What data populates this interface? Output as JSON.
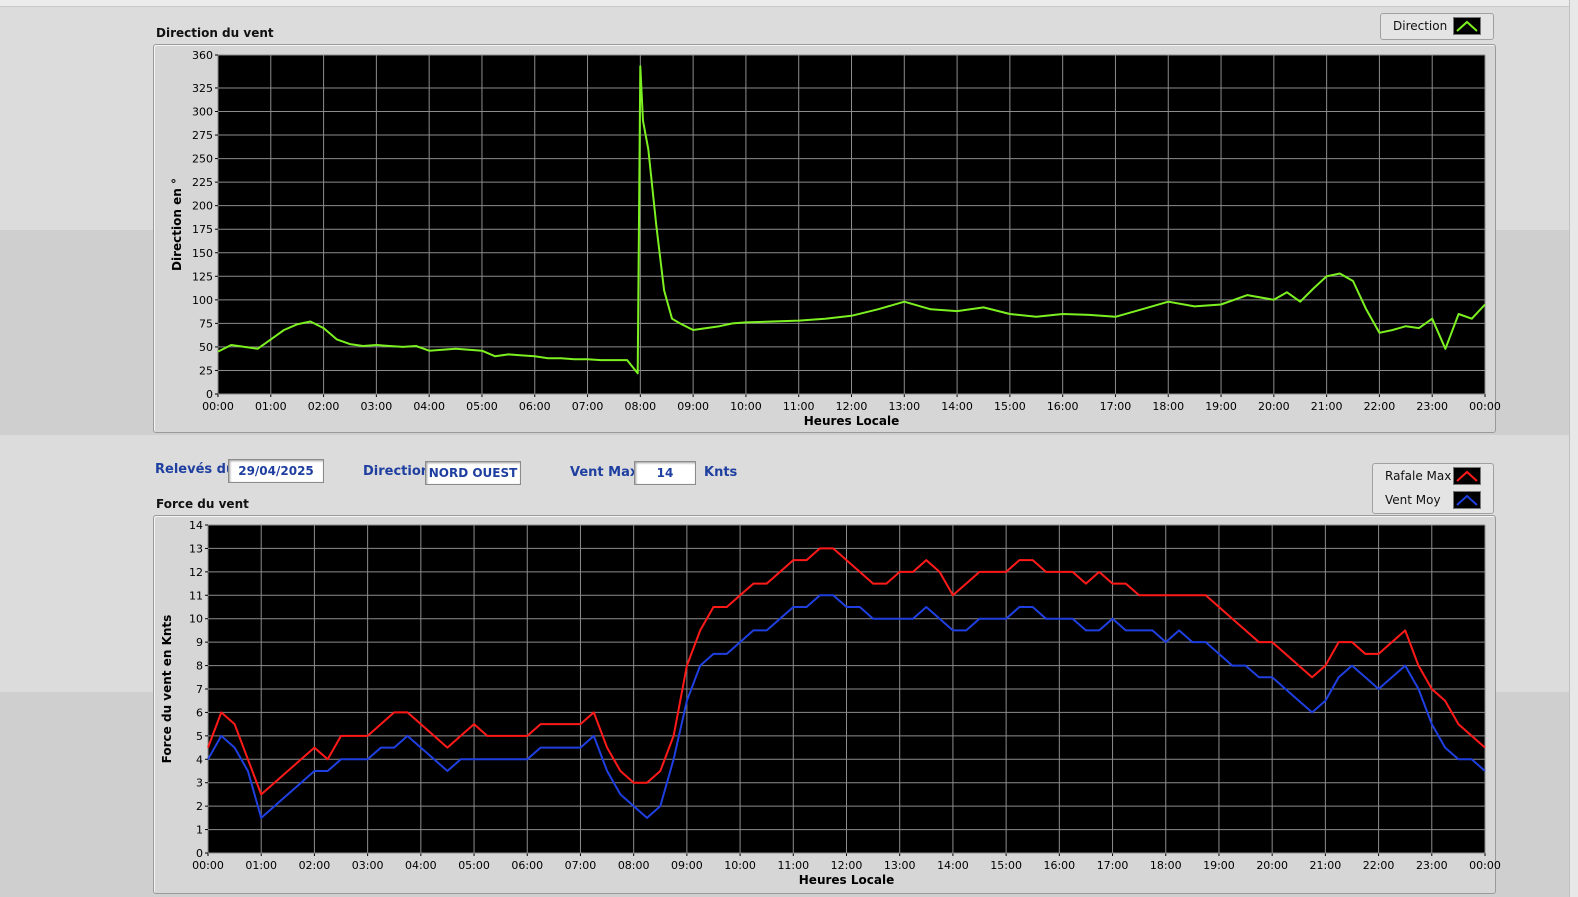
{
  "colors": {
    "plot_bg": "#000000",
    "grid": "#8c8c8c",
    "direction": "#7cf020",
    "rafale": "#ff1a1a",
    "moyen": "#1f3fe0",
    "control_text": "#1e3fa0"
  },
  "controls": {
    "releves_label": "Relevés du",
    "releves_value": "29/04/2025",
    "direction_label": "Direction",
    "direction_value": "NORD OUEST",
    "ventmax_label": "Vent Max",
    "ventmax_value": "14",
    "ventmax_unit": "Knts"
  },
  "legend_top": {
    "label": "Direction"
  },
  "legend_bottom": {
    "items": [
      "Rafale Max",
      "Vent Moy"
    ]
  },
  "chart_data": [
    {
      "type": "line",
      "title": "Direction du vent",
      "xlabel": "Heures Locale",
      "ylabel": "Direction en °",
      "x_ticks": [
        "00:00",
        "01:00",
        "02:00",
        "03:00",
        "04:00",
        "05:00",
        "06:00",
        "07:00",
        "08:00",
        "09:00",
        "10:00",
        "11:00",
        "12:00",
        "13:00",
        "14:00",
        "15:00",
        "16:00",
        "17:00",
        "18:00",
        "19:00",
        "20:00",
        "21:00",
        "22:00",
        "23:00",
        "00:00"
      ],
      "y_ticks": [
        0,
        25,
        50,
        75,
        100,
        125,
        150,
        175,
        200,
        225,
        250,
        275,
        300,
        325,
        360
      ],
      "xlim": [
        0,
        24
      ],
      "ylim": [
        0,
        360
      ],
      "grid": true,
      "legend": "top-right",
      "series": [
        {
          "name": "Direction",
          "x": [
            0,
            0.25,
            0.5,
            0.75,
            1,
            1.25,
            1.5,
            1.75,
            2,
            2.25,
            2.5,
            2.75,
            3,
            3.25,
            3.5,
            3.75,
            4,
            4.25,
            4.5,
            4.75,
            5,
            5.25,
            5.5,
            5.75,
            6,
            6.25,
            6.5,
            6.75,
            7,
            7.25,
            7.5,
            7.75,
            7.95,
            8,
            8.05,
            8.15,
            8.3,
            8.45,
            8.6,
            8.75,
            9,
            9.25,
            9.5,
            9.75,
            10,
            10.5,
            11,
            11.5,
            12,
            12.5,
            13,
            13.5,
            14,
            14.5,
            15,
            15.5,
            16,
            16.5,
            17,
            17.5,
            18,
            18.5,
            19,
            19.5,
            20,
            20.25,
            20.5,
            20.75,
            21,
            21.25,
            21.5,
            21.75,
            22,
            22.25,
            22.5,
            22.75,
            23,
            23.25,
            23.5,
            23.75,
            24
          ],
          "values": [
            45,
            52,
            50,
            48,
            58,
            68,
            74,
            77,
            70,
            58,
            53,
            51,
            52,
            51,
            50,
            51,
            46,
            47,
            48,
            47,
            46,
            40,
            42,
            41,
            40,
            38,
            38,
            37,
            37,
            36,
            36,
            36,
            22,
            348,
            290,
            260,
            180,
            110,
            80,
            75,
            68,
            70,
            72,
            75,
            76,
            77,
            78,
            80,
            83,
            90,
            98,
            90,
            88,
            92,
            85,
            82,
            85,
            84,
            82,
            90,
            98,
            93,
            95,
            105,
            100,
            108,
            98,
            112,
            125,
            128,
            120,
            90,
            65,
            68,
            72,
            70,
            80,
            48,
            85,
            80,
            95
          ]
        }
      ]
    },
    {
      "type": "line",
      "title": "Force du vent",
      "xlabel": "Heures Locale",
      "ylabel": "Force du vent en Knts",
      "x_ticks": [
        "00:00",
        "01:00",
        "02:00",
        "03:00",
        "04:00",
        "05:00",
        "06:00",
        "07:00",
        "08:00",
        "09:00",
        "10:00",
        "11:00",
        "12:00",
        "13:00",
        "14:00",
        "15:00",
        "16:00",
        "17:00",
        "18:00",
        "19:00",
        "20:00",
        "21:00",
        "22:00",
        "23:00",
        "00:00"
      ],
      "y_ticks": [
        0,
        1,
        2,
        3,
        4,
        5,
        6,
        7,
        8,
        9,
        10,
        11,
        12,
        13,
        14
      ],
      "xlim": [
        0,
        24
      ],
      "ylim": [
        0,
        14
      ],
      "grid": true,
      "legend": "top-right",
      "series": [
        {
          "name": "Rafale Max",
          "x": [
            0,
            0.25,
            0.5,
            0.75,
            1,
            1.25,
            1.5,
            1.75,
            2,
            2.25,
            2.5,
            2.75,
            3,
            3.25,
            3.5,
            3.75,
            4,
            4.25,
            4.5,
            4.75,
            5,
            5.25,
            5.5,
            5.75,
            6,
            6.25,
            6.5,
            6.75,
            7,
            7.25,
            7.5,
            7.75,
            8,
            8.25,
            8.5,
            8.75,
            9,
            9.25,
            9.5,
            9.75,
            10,
            10.25,
            10.5,
            10.75,
            11,
            11.25,
            11.5,
            11.75,
            12,
            12.25,
            12.5,
            12.75,
            13,
            13.25,
            13.5,
            13.75,
            14,
            14.25,
            14.5,
            14.75,
            15,
            15.25,
            15.5,
            15.75,
            16,
            16.25,
            16.5,
            16.75,
            17,
            17.25,
            17.5,
            17.75,
            18,
            18.25,
            18.5,
            18.75,
            19,
            19.25,
            19.5,
            19.75,
            20,
            20.25,
            20.5,
            20.75,
            21,
            21.25,
            21.5,
            21.75,
            22,
            22.25,
            22.5,
            22.75,
            23,
            23.25,
            23.5,
            23.75,
            24
          ],
          "values": [
            4.5,
            6.0,
            5.5,
            4.0,
            2.5,
            3.0,
            3.5,
            4.0,
            4.5,
            4.0,
            5.0,
            5.0,
            5.0,
            5.5,
            6.0,
            6.0,
            5.5,
            5.0,
            4.5,
            5.0,
            5.5,
            5.0,
            5.0,
            5.0,
            5.0,
            5.5,
            5.5,
            5.5,
            5.5,
            6.0,
            4.5,
            3.5,
            3.0,
            3.0,
            3.5,
            5.0,
            8.0,
            9.5,
            10.5,
            10.5,
            11.0,
            11.5,
            11.5,
            12.0,
            12.5,
            12.5,
            13.0,
            13.0,
            12.5,
            12.0,
            11.5,
            11.5,
            12.0,
            12.0,
            12.5,
            12.0,
            11.0,
            11.5,
            12.0,
            12.0,
            12.0,
            12.5,
            12.5,
            12.0,
            12.0,
            12.0,
            11.5,
            12.0,
            11.5,
            11.5,
            11.0,
            11.0,
            11.0,
            11.0,
            11.0,
            11.0,
            10.5,
            10.0,
            9.5,
            9.0,
            9.0,
            8.5,
            8.0,
            7.5,
            8.0,
            9.0,
            9.0,
            8.5,
            8.5,
            9.0,
            9.5,
            8.0,
            7.0,
            6.5,
            5.5,
            5.0,
            4.5
          ]
        },
        {
          "name": "Vent Moy",
          "x": [
            0,
            0.25,
            0.5,
            0.75,
            1,
            1.25,
            1.5,
            1.75,
            2,
            2.25,
            2.5,
            2.75,
            3,
            3.25,
            3.5,
            3.75,
            4,
            4.25,
            4.5,
            4.75,
            5,
            5.25,
            5.5,
            5.75,
            6,
            6.25,
            6.5,
            6.75,
            7,
            7.25,
            7.5,
            7.75,
            8,
            8.25,
            8.5,
            8.75,
            9,
            9.25,
            9.5,
            9.75,
            10,
            10.25,
            10.5,
            10.75,
            11,
            11.25,
            11.5,
            11.75,
            12,
            12.25,
            12.5,
            12.75,
            13,
            13.25,
            13.5,
            13.75,
            14,
            14.25,
            14.5,
            14.75,
            15,
            15.25,
            15.5,
            15.75,
            16,
            16.25,
            16.5,
            16.75,
            17,
            17.25,
            17.5,
            17.75,
            18,
            18.25,
            18.5,
            18.75,
            19,
            19.25,
            19.5,
            19.75,
            20,
            20.25,
            20.5,
            20.75,
            21,
            21.25,
            21.5,
            21.75,
            22,
            22.25,
            22.5,
            22.75,
            23,
            23.25,
            23.5,
            23.75,
            24
          ],
          "values": [
            4.0,
            5.0,
            4.5,
            3.5,
            1.5,
            2.0,
            2.5,
            3.0,
            3.5,
            3.5,
            4.0,
            4.0,
            4.0,
            4.5,
            4.5,
            5.0,
            4.5,
            4.0,
            3.5,
            4.0,
            4.0,
            4.0,
            4.0,
            4.0,
            4.0,
            4.5,
            4.5,
            4.5,
            4.5,
            5.0,
            3.5,
            2.5,
            2.0,
            1.5,
            2.0,
            4.0,
            6.5,
            8.0,
            8.5,
            8.5,
            9.0,
            9.5,
            9.5,
            10.0,
            10.5,
            10.5,
            11.0,
            11.0,
            10.5,
            10.5,
            10.0,
            10.0,
            10.0,
            10.0,
            10.5,
            10.0,
            9.5,
            9.5,
            10.0,
            10.0,
            10.0,
            10.5,
            10.5,
            10.0,
            10.0,
            10.0,
            9.5,
            9.5,
            10.0,
            9.5,
            9.5,
            9.5,
            9.0,
            9.5,
            9.0,
            9.0,
            8.5,
            8.0,
            8.0,
            7.5,
            7.5,
            7.0,
            6.5,
            6.0,
            6.5,
            7.5,
            8.0,
            7.5,
            7.0,
            7.5,
            8.0,
            7.0,
            5.5,
            4.5,
            4.0,
            4.0,
            3.5
          ]
        }
      ]
    }
  ]
}
